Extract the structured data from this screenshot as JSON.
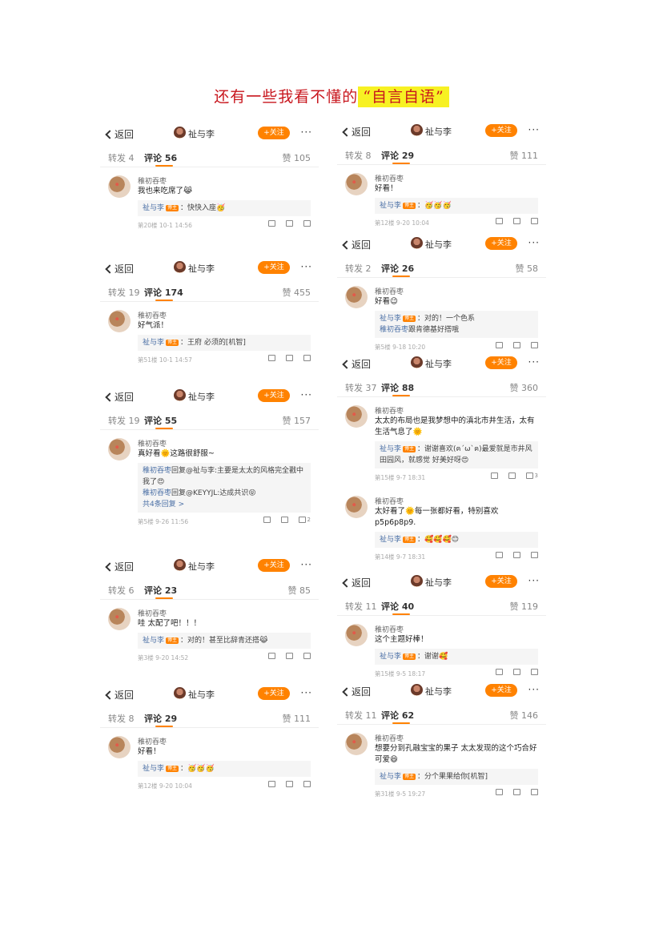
{
  "title": {
    "prefix": "还有一些我看不懂的",
    "highlight": "“自言自语”"
  },
  "common": {
    "back_label": "返回",
    "user": "祉与李",
    "follow_label": "+关注",
    "more_label": "···",
    "tag": "博主",
    "commenter": "稚初吞枣"
  },
  "shots": [
    {
      "fwd": "转发 4",
      "cmt": "评论 56",
      "like": "赞 105",
      "text": "我也来吃席了😹",
      "replies": [
        {
          "user": "祉与李",
          "tag": true,
          "text": "快快入座🥳"
        }
      ],
      "meta": "第20楼 10-1 14:56",
      "likes": ""
    },
    {
      "fwd": "转发 19",
      "cmt": "评论 174",
      "like": "赞 455",
      "text": "好气派！",
      "replies": [
        {
          "user": "祉与李",
          "tag": true,
          "text": "王府 必须的[机智]"
        }
      ],
      "meta": "第51楼 10-1 14:57",
      "likes": ""
    },
    {
      "fwd": "转发 19",
      "cmt": "评论 55",
      "like": "赞 157",
      "text": "真好看🌞这路很舒服~",
      "replies": [
        {
          "user": "稚初吞枣",
          "tag": false,
          "text": "回复@祉与李:主要是太太的风格完全戳中我了😍"
        },
        {
          "user": "稚初吞枣",
          "tag": false,
          "text": "回复@KEYYJL:达成共识😝"
        }
      ],
      "more": "共4条回复 >",
      "meta": "第5楼 9-26 11:56",
      "likes": "2"
    },
    {
      "fwd": "转发 6",
      "cmt": "评论 23",
      "like": "赞 85",
      "text": "哇 太配了吧！！！",
      "replies": [
        {
          "user": "祉与李",
          "tag": true,
          "text": "对的！甚至比辞青还搭😹"
        }
      ],
      "meta": "第3楼 9-20 14:52",
      "likes": ""
    },
    {
      "fwd": "转发 8",
      "cmt": "评论 29",
      "like": "赞 111",
      "text": "好看！",
      "replies": [
        {
          "user": "祉与李",
          "tag": true,
          "text": "🥳🥳🥳"
        }
      ],
      "meta": "第12楼 9-20 10:04",
      "likes": ""
    },
    {
      "fwd": "转发 8",
      "cmt": "评论 29",
      "like": "赞 111",
      "text": "好看！",
      "replies": [
        {
          "user": "祉与李",
          "tag": true,
          "text": "🥳🥳🥳"
        }
      ],
      "meta": "第12楼 9-20 10:04",
      "likes": ""
    },
    {
      "fwd": "转发 2",
      "cmt": "评论 26",
      "like": "赞 58",
      "text": "好看😉",
      "replies": [
        {
          "user": "祉与李",
          "tag": true,
          "text": "对的！一个色系"
        },
        {
          "user": "稚初吞枣",
          "tag": false,
          "text": "跟肯德基好搭哦"
        }
      ],
      "meta": "第5楼 9-18 10:20",
      "likes": ""
    },
    {
      "fwd": "转发 37",
      "cmt": "评论 88",
      "like": "赞 360",
      "text": "太太的布局也是我梦想中的滇北市井生活，太有生活气息了🌞",
      "replies": [
        {
          "user": "祉与李",
          "tag": true,
          "text": "谢谢喜欢(ฅ´ω`ฅ)最爱就是市井风田园风，就感觉 好美好呀😍"
        }
      ],
      "meta": "第15楼 9-7 18:31",
      "likes": "3",
      "text2": "太好看了🌞每一张都好看，特别喜欢p5p6p8p9.",
      "replies2": [
        {
          "user": "祉与李",
          "tag": true,
          "text": "🥰🥰🥰😊"
        }
      ],
      "meta2": "第14楼 9-7 18:31"
    },
    {
      "fwd": "转发 11",
      "cmt": "评论 40",
      "like": "赞 119",
      "text": "这个主题好棒！",
      "replies": [
        {
          "user": "祉与李",
          "tag": true,
          "text": "谢谢🥰"
        }
      ],
      "meta": "第15楼 9-5 18:17",
      "likes": ""
    },
    {
      "fwd": "转发 11",
      "cmt": "评论 62",
      "like": "赞 146",
      "text": "想要分到孔融宝宝的果子 太太发现的这个巧合好可爱😆",
      "replies": [
        {
          "user": "祉与李",
          "tag": true,
          "text": "分个果果给你[机智]"
        }
      ],
      "meta": "第31楼 9-5 19:27",
      "likes": ""
    }
  ]
}
